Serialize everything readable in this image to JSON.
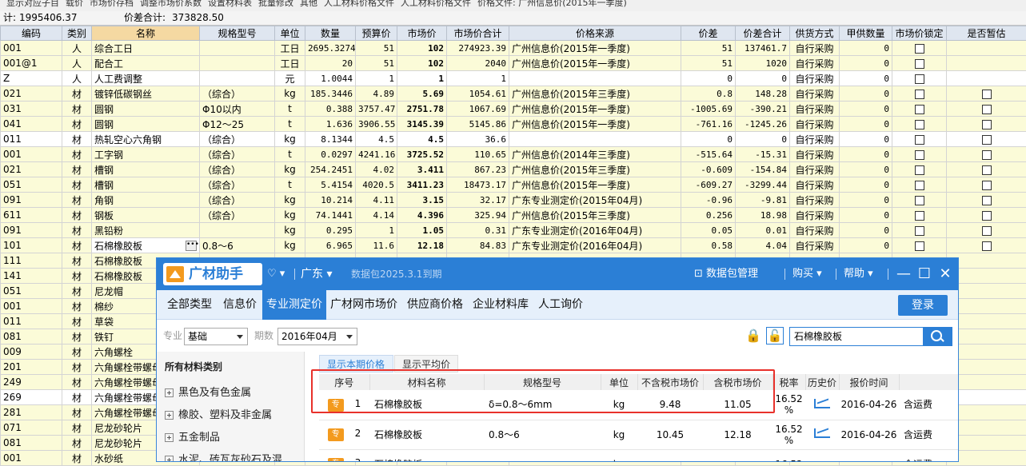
{
  "toolbar_items": [
    "显示对应子目",
    "载价",
    "市场价存档",
    "调整市场价系数",
    "设置材料表",
    "批量修改",
    "其他",
    "人工材料价格文件",
    "人工材料价格文件",
    "价格文件: 广州信息价(2015年一季度)"
  ],
  "summary": {
    "total_label": "计:",
    "total_value": "1995406.37",
    "diff_label": "价差合计:",
    "diff_value": "373828.50"
  },
  "grid": {
    "headers": [
      "编码",
      "类别",
      "名称",
      "规格型号",
      "单位",
      "数量",
      "预算价",
      "市场价",
      "市场价合计",
      "价格来源",
      "价差",
      "价差合计",
      "供货方式",
      "甲供数量",
      "市场价锁定",
      "是否暂估"
    ],
    "rows": [
      {
        "code": "001",
        "type": "人",
        "name": "综合工日",
        "spec": "",
        "unit": "工日",
        "qty": "2695.3274",
        "budget": "51",
        "market": "102",
        "total": "274923.39",
        "source": "广州信息价(2015年一季度)",
        "diff": "51",
        "diffsum": "137461.7",
        "supply": "自行采购",
        "jia": "0",
        "lock": true,
        "zan": false,
        "hl": true
      },
      {
        "code": "001@1",
        "type": "人",
        "name": "配合工",
        "spec": "",
        "unit": "工日",
        "qty": "20",
        "budget": "51",
        "market": "102",
        "total": "2040",
        "source": "广州信息价(2015年一季度)",
        "diff": "51",
        "diffsum": "1020",
        "supply": "自行采购",
        "jia": "0",
        "lock": true,
        "zan": false,
        "hl": true
      },
      {
        "code": "Z",
        "type": "人",
        "name": "人工费调整",
        "spec": "",
        "unit": "元",
        "qty": "1.0044",
        "budget": "1",
        "market": "1",
        "total": "1",
        "source": "",
        "diff": "0",
        "diffsum": "0",
        "supply": "自行采购",
        "jia": "0",
        "lock": true,
        "zan": false,
        "hl": false
      },
      {
        "code": "021",
        "type": "材",
        "name": "镀锌低碳钢丝",
        "spec": "（综合）",
        "unit": "kg",
        "qty": "185.3446",
        "budget": "4.89",
        "market": "5.69",
        "total": "1054.61",
        "source": "广州信息价(2015年三季度)",
        "diff": "0.8",
        "diffsum": "148.28",
        "supply": "自行采购",
        "jia": "0",
        "lock": true,
        "zan": true,
        "hl": true
      },
      {
        "code": "031",
        "type": "材",
        "name": "圆钢",
        "spec": "Φ10以内",
        "unit": "t",
        "qty": "0.388",
        "budget": "3757.47",
        "market": "2751.78",
        "total": "1067.69",
        "source": "广州信息价(2015年一季度)",
        "diff": "-1005.69",
        "diffsum": "-390.21",
        "supply": "自行采购",
        "jia": "0",
        "lock": true,
        "zan": true,
        "hl": true
      },
      {
        "code": "041",
        "type": "材",
        "name": "圆钢",
        "spec": "Φ12～25",
        "unit": "t",
        "qty": "1.636",
        "budget": "3906.55",
        "market": "3145.39",
        "total": "5145.86",
        "source": "广州信息价(2015年一季度)",
        "diff": "-761.16",
        "diffsum": "-1245.26",
        "supply": "自行采购",
        "jia": "0",
        "lock": true,
        "zan": true,
        "hl": true
      },
      {
        "code": "011",
        "type": "材",
        "name": "热轧空心六角钢",
        "spec": "（综合）",
        "unit": "kg",
        "qty": "8.1344",
        "budget": "4.5",
        "market": "4.5",
        "total": "36.6",
        "source": "",
        "diff": "0",
        "diffsum": "0",
        "supply": "自行采购",
        "jia": "0",
        "lock": true,
        "zan": true,
        "hl": false
      },
      {
        "code": "001",
        "type": "材",
        "name": "工字钢",
        "spec": "（综合）",
        "unit": "t",
        "qty": "0.0297",
        "budget": "4241.16",
        "market": "3725.52",
        "total": "110.65",
        "source": "广州信息价(2014年三季度)",
        "diff": "-515.64",
        "diffsum": "-15.31",
        "supply": "自行采购",
        "jia": "0",
        "lock": true,
        "zan": true,
        "hl": true
      },
      {
        "code": "021",
        "type": "材",
        "name": "槽钢",
        "spec": "（综合）",
        "unit": "kg",
        "qty": "254.2451",
        "budget": "4.02",
        "market": "3.411",
        "total": "867.23",
        "source": "广州信息价(2015年三季度)",
        "diff": "-0.609",
        "diffsum": "-154.84",
        "supply": "自行采购",
        "jia": "0",
        "lock": true,
        "zan": true,
        "hl": true
      },
      {
        "code": "051",
        "type": "材",
        "name": "槽钢",
        "spec": "（综合）",
        "unit": "t",
        "qty": "5.4154",
        "budget": "4020.5",
        "market": "3411.23",
        "total": "18473.17",
        "source": "广州信息价(2015年一季度)",
        "diff": "-609.27",
        "diffsum": "-3299.44",
        "supply": "自行采购",
        "jia": "0",
        "lock": true,
        "zan": true,
        "hl": true
      },
      {
        "code": "091",
        "type": "材",
        "name": "角钢",
        "spec": "（综合）",
        "unit": "kg",
        "qty": "10.214",
        "budget": "4.11",
        "market": "3.15",
        "total": "32.17",
        "source": "广东专业测定价(2015年04月)",
        "diff": "-0.96",
        "diffsum": "-9.81",
        "supply": "自行采购",
        "jia": "0",
        "lock": true,
        "zan": true,
        "hl": true
      },
      {
        "code": "611",
        "type": "材",
        "name": "钢板",
        "spec": "（综合）",
        "unit": "kg",
        "qty": "74.1441",
        "budget": "4.14",
        "market": "4.396",
        "total": "325.94",
        "source": "广州信息价(2015年三季度)",
        "diff": "0.256",
        "diffsum": "18.98",
        "supply": "自行采购",
        "jia": "0",
        "lock": true,
        "zan": true,
        "hl": true
      },
      {
        "code": "091",
        "type": "材",
        "name": "黑铅粉",
        "spec": "",
        "unit": "kg",
        "qty": "0.295",
        "budget": "1",
        "market": "1.05",
        "total": "0.31",
        "source": "广东专业测定价(2016年04月)",
        "diff": "0.05",
        "diffsum": "0.01",
        "supply": "自行采购",
        "jia": "0",
        "lock": true,
        "zan": true,
        "hl": true
      },
      {
        "code": "101",
        "type": "材",
        "name": "石棉橡胶板",
        "spec": "0.8～6",
        "unit": "kg",
        "qty": "6.965",
        "budget": "11.6",
        "market": "12.18",
        "total": "84.83",
        "source": "广东专业测定价(2016年04月)",
        "diff": "0.58",
        "diffsum": "4.04",
        "supply": "自行采购",
        "jia": "0",
        "lock": true,
        "zan": true,
        "hl": true,
        "edit": true
      },
      {
        "code": "111",
        "type": "材",
        "name": "石棉橡胶板",
        "hl": true
      },
      {
        "code": "141",
        "type": "材",
        "name": "石棉橡胶板",
        "hl": true
      },
      {
        "code": "051",
        "type": "材",
        "name": "尼龙帽",
        "hl": true
      },
      {
        "code": "001",
        "type": "材",
        "name": "棉纱",
        "hl": true
      },
      {
        "code": "011",
        "type": "材",
        "name": "草袋",
        "hl": true
      },
      {
        "code": "081",
        "type": "材",
        "name": "铁钉",
        "hl": true
      },
      {
        "code": "009",
        "type": "材",
        "name": "六角螺栓",
        "hl": true
      },
      {
        "code": "201",
        "type": "材",
        "name": "六角螺栓带螺母",
        "hl": true
      },
      {
        "code": "249",
        "type": "材",
        "name": "六角螺栓带螺母",
        "hl": true
      },
      {
        "code": "269",
        "type": "材",
        "name": "六角螺栓带螺母",
        "hl": false
      },
      {
        "code": "281",
        "type": "材",
        "name": "六角螺栓带螺母",
        "hl": true
      },
      {
        "code": "071",
        "type": "材",
        "name": "尼龙砂轮片",
        "hl": true
      },
      {
        "code": "081",
        "type": "材",
        "name": "尼龙砂轮片",
        "hl": true
      },
      {
        "code": "001",
        "type": "材",
        "name": "水砂纸",
        "hl": true
      }
    ]
  },
  "popup": {
    "brand": "广材助手",
    "region": "广东",
    "package_info": "数据包2025.3.1到期",
    "package_mgmt": "数据包管理",
    "buy": "购买",
    "help": "帮助",
    "nav": [
      "全部类型",
      "信息价",
      "专业测定价",
      "广材网市场价",
      "供应商价格",
      "企业材料库",
      "人工询价"
    ],
    "nav_active": 2,
    "login": "登录",
    "specialty_label": "专业",
    "specialty_value": "基础",
    "period_label": "期数",
    "period_value": "2016年04月",
    "search_value": "石棉橡胶板",
    "side_title": "所有材料类别",
    "categories": [
      "黑色及有色金属",
      "橡胶、塑料及非金属",
      "五金制品",
      "水泥、砖瓦灰砂石及混..."
    ],
    "tab_current": "显示本期价格",
    "tab_avg": "显示平均价",
    "columns": [
      "序号",
      "材料名称",
      "规格型号",
      "单位",
      "不含税市场价",
      "含税市场价",
      "税率",
      "历史价",
      "报价时间",
      ""
    ],
    "badge": "专",
    "rows": [
      {
        "no": "1",
        "name": "石棉橡胶板",
        "spec": "δ=0.8～6mm",
        "unit": "kg",
        "pre": "9.48",
        "post": "11.05",
        "tax1": "16.52",
        "tax2": "%",
        "date": "2016-04-26",
        "note": "含运费"
      },
      {
        "no": "2",
        "name": "石棉橡胶板",
        "spec": "0.8～6",
        "unit": "kg",
        "pre": "10.45",
        "post": "12.18",
        "tax1": "16.52",
        "tax2": "%",
        "date": "2016-04-26",
        "note": "含运费"
      },
      {
        "no": "3",
        "name": "石棉橡胶板",
        "spec": "",
        "unit": "kg",
        "pre": "",
        "post": "",
        "tax1": "16.52",
        "tax2": "",
        "date": "",
        "note": "含运费"
      }
    ]
  }
}
